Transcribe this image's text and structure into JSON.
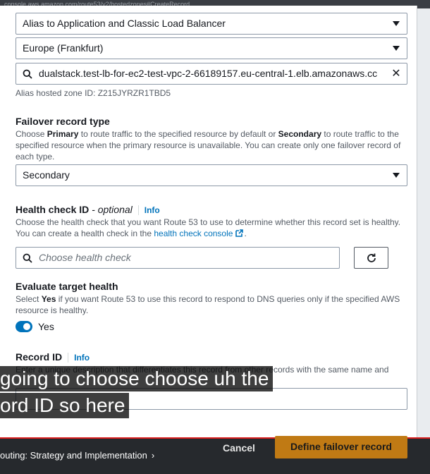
{
  "browser": {
    "url_fragment": "console.aws.amazon.com/route53/v2/hostedzones#CreateRecord"
  },
  "routing": {
    "target_type": "Alias to Application and Classic Load Balancer",
    "region": "Europe (Frankfurt)",
    "endpoint": "dualstack.test-lb-for-ec2-test-vpc-2-66189157.eu-central-1.elb.amazonaws.cc",
    "hosted_zone": "Alias hosted zone ID: Z215JYRZR1TBD5"
  },
  "failover": {
    "label": "Failover record type",
    "desc_prefix": "Choose ",
    "desc_primary": "Primary",
    "desc_mid": " to route traffic to the specified resource by default or ",
    "desc_secondary": "Secondary",
    "desc_suffix": " to route traffic to the specified resource when the primary resource is unavailable. You can create only one failover record of each type.",
    "value": "Secondary"
  },
  "health_check": {
    "label": "Health check ID",
    "optional": " - optional",
    "info": "Info",
    "desc": "Choose the health check that you want Route 53 to use to determine whether this record set is healthy. You can create a health check in the ",
    "link": "health check console",
    "desc_end": ".",
    "placeholder": "Choose health check"
  },
  "evaluate": {
    "label": "Evaluate target health",
    "desc_prefix": "Select ",
    "desc_yes": "Yes",
    "desc_suffix": " if you want Route 53 to use this record to respond to DNS queries only if the specified AWS resource is healthy.",
    "toggle_label": "Yes",
    "toggle_on": true
  },
  "record_id": {
    "label": "Record ID",
    "info": "Info",
    "desc": "Enter a unique description that differentiates this record from other records with the same name and"
  },
  "footer": {
    "cancel": "Cancel",
    "define": "Define failover record",
    "chapter": "outing: Strategy and Implementation"
  },
  "captions": {
    "line1": " going to choose choose uh the",
    "line2": "ord ID so here"
  },
  "colors": {
    "link": "#0073bb",
    "primary_button": "#c07a14",
    "toggle": "#0073bb",
    "progress_bar": "#d91c1c"
  }
}
